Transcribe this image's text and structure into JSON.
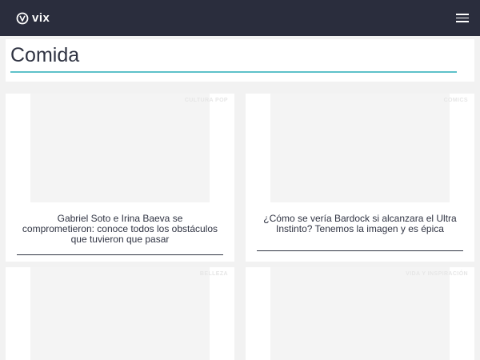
{
  "brand": {
    "logo_text": "vix",
    "logo_icon": "vix-logo-icon"
  },
  "header": {
    "menu_icon": "hamburger-menu-icon"
  },
  "page": {
    "title": "Comida",
    "accent_color": "#5ec1c9",
    "header_color": "#2a2d3d"
  },
  "articles": [
    {
      "category": "CULTURA POP",
      "title": "Gabriel Soto e Irina Baeva se comprometieron: conoce todos los obstáculos que tuvieron que pasar"
    },
    {
      "category": "COMICS",
      "title": "¿Cómo se vería Bardock si alcanzara el Ultra Instinto? Tenemos la imagen y es épica"
    },
    {
      "category": "BELLEZA",
      "title": ""
    },
    {
      "category": "VIDA Y INSPIRACIÓN",
      "title": ""
    }
  ]
}
